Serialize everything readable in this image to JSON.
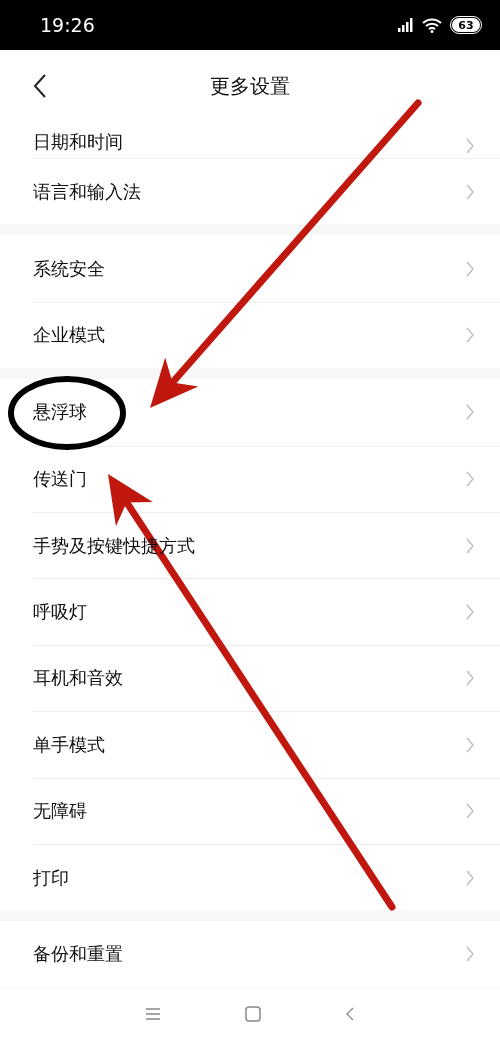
{
  "status_bar": {
    "time": "19:26",
    "battery": "63"
  },
  "header": {
    "title": "更多设置"
  },
  "groups": [
    {
      "items": [
        "日期和时间",
        "语言和输入法"
      ]
    },
    {
      "items": [
        "系统安全",
        "企业模式"
      ]
    },
    {
      "items": [
        "悬浮球",
        "传送门",
        "手势及按键快捷方式",
        "呼吸灯",
        "耳机和音效",
        "单手模式",
        "无障碍",
        "打印"
      ]
    },
    {
      "items": [
        "备份和重置"
      ]
    }
  ],
  "annotations": [
    {
      "kind": "arrow"
    },
    {
      "kind": "arrow"
    },
    {
      "kind": "ellipse"
    }
  ]
}
